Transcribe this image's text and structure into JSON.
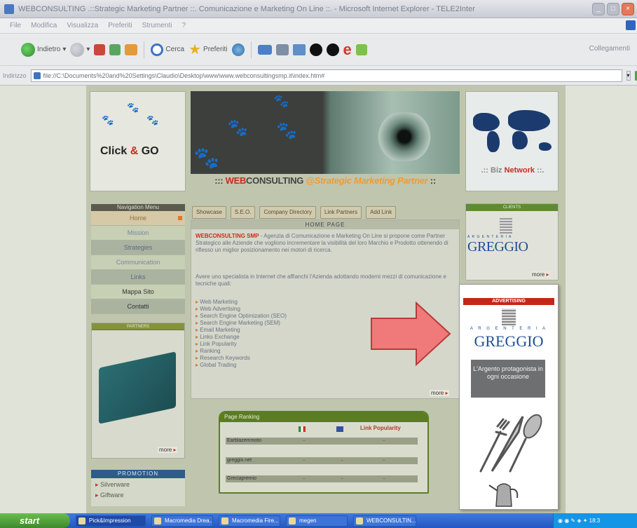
{
  "window": {
    "title": "WEBCONSULTING .::Strategic Marketing Partner ::. Comunicazione e Marketing On Line ::. - Microsoft Internet Explorer - TELE2Inter",
    "controls": [
      "_",
      "□",
      "×"
    ]
  },
  "menu": {
    "items": [
      "File",
      "Modifica",
      "Visualizza",
      "Preferiti",
      "Strumenti",
      "?"
    ]
  },
  "toolbar": {
    "back_label": "Indietro",
    "search_label": "Cerca",
    "favorites_label": "Preferiti",
    "links_label": "Collegamenti"
  },
  "address": {
    "label": "Indirizzo",
    "value": "file://C:\\Documents%20and%20Settings\\Claudio\\Desktop\\www\\www.webconsultingsmp.it\\index.htm#"
  },
  "site": {
    "logo_text_1": "Click",
    "logo_amp": "&",
    "logo_text_2": "GO",
    "brand_prefix": "::: ",
    "brand_web": "WEB",
    "brand_consulting": "CONSULTING ",
    "brand_tagline": "@Strategic Marketing Partner",
    "brand_suffix": " ::",
    "map_prefix": ".:: Biz ",
    "map_red": "Network",
    "map_suffix": " ::.",
    "nav_title": "Navigation Menu",
    "nav_items": [
      "Home",
      "Mission",
      "Strategies",
      "Communication",
      "Links",
      "Mappa Sito",
      "Contatti"
    ],
    "left_promo_title": "PARTNERS",
    "left_promo_more": "more",
    "promotion_title": "PROMOTION",
    "promotion_links": [
      "Silverware",
      "Giftware"
    ],
    "tabs": [
      "Showcase",
      "S.E.O.",
      "Company Directory",
      "Link Partners",
      "Add Link"
    ],
    "content_header": "HOME PAGE",
    "intro_red": "WEBCONSULTING SMP",
    "intro_text": " - Agenzia di Comunicazione e Marketing On Line si propone come Partner Strategico alle Aziende che vogliono incrementare la visibilità del loro Marchio e Prodotto ottenendo di riflesso un miglior posizionamento nei motori di ricerca.",
    "intro2_text": "Avere uno specialista in Internet che affianchi l'Azienda adottando moderni mezzi di comunicazione e tecniche quali:",
    "services": [
      "Web Marketing",
      "Web Advertising",
      "Search Engine Optimization (SEO)",
      "Search Engine Marketing (SEM)",
      "Email Marketing",
      "Links Exchange",
      "Link Popularity",
      "Ranking",
      "Research Keywords",
      "Global Trading"
    ],
    "content_more": "more",
    "ranking_title": "Page Ranking",
    "ranking_lp_label": "Link Popularity",
    "ranking_rows": [
      "Earblazemmoto",
      "greggio.net",
      "Greciapremio"
    ],
    "ranking_dash": "–",
    "client_title": "CLIENTS",
    "client_argenteria": "A R G E N T E R I A",
    "client_brand": "GREGGIO",
    "client_more": "more"
  },
  "ad": {
    "header": "ADVERTISING",
    "argenteria": "A R G E N T E R I A",
    "brand": "GREGGIO",
    "tagline": "L'Argento protagonista in ogni occasione",
    "arrow_color": "#f07a7a"
  },
  "taskbar": {
    "start": "start",
    "tasks": [
      "Pick&Impression",
      "Macromedia Drea...",
      "Macromedia Fire...",
      "megen",
      "WEBCONSULTIN..."
    ],
    "clock": "18:3"
  }
}
